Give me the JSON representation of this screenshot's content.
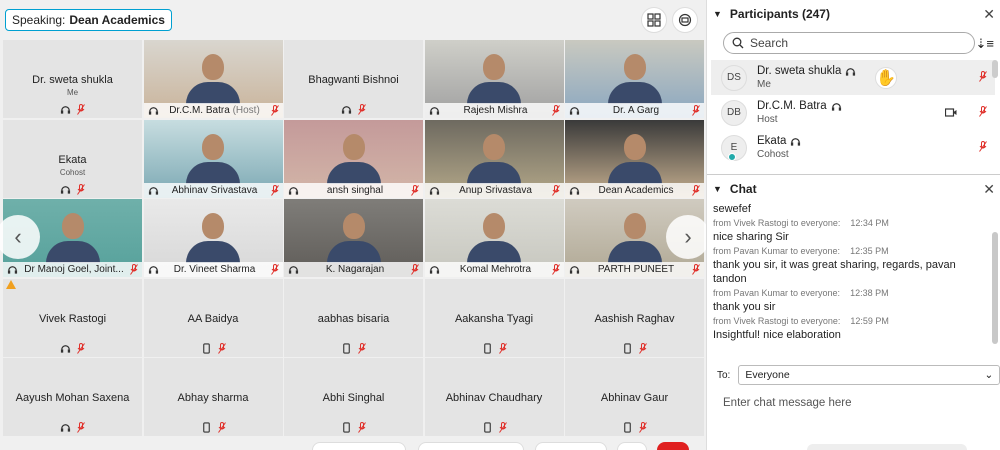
{
  "speaking": {
    "label": "Speaking:",
    "name": "Dean Academics"
  },
  "tiles": [
    {
      "name": "Dr. sweta shukla",
      "role": "Me",
      "video": false
    },
    {
      "name": "Dr.C.M. Batra",
      "host": "(Host)",
      "video": true
    },
    {
      "name": "Bhagwanti Bishnoi",
      "video": false
    },
    {
      "name": "Rajesh Mishra",
      "video": true
    },
    {
      "name": "Dr. A Garg",
      "video": true
    },
    {
      "name": "Ekata",
      "role": "Cohost",
      "video": false
    },
    {
      "name": "Abhinav Srivastava",
      "video": true
    },
    {
      "name": "ansh singhal",
      "video": true
    },
    {
      "name": "Anup Srivastava",
      "video": true
    },
    {
      "name": "Dean Academics",
      "video": true,
      "highlight": true
    },
    {
      "name": "Dr Manoj Goel, Joint...",
      "video": true
    },
    {
      "name": "Dr. Vineet Sharma",
      "video": true
    },
    {
      "name": "K. Nagarajan",
      "video": true
    },
    {
      "name": "Komal Mehrotra",
      "video": true
    },
    {
      "name": "PARTH PUNEET",
      "video": true
    },
    {
      "name": "Vivek Rastogi",
      "video": false
    },
    {
      "name": "AA Baidya",
      "video": false
    },
    {
      "name": "aabhas bisaria",
      "video": false
    },
    {
      "name": "Aakansha Tyagi",
      "video": false
    },
    {
      "name": "Aashish Raghav",
      "video": false
    },
    {
      "name": "Aayush Mohan Saxena",
      "video": false
    },
    {
      "name": "Abhay sharma",
      "video": false
    },
    {
      "name": "Abhi Singhal",
      "video": false
    },
    {
      "name": "Abhinav Chaudhary",
      "video": false
    },
    {
      "name": "Abhinav Gaur",
      "video": false
    }
  ],
  "participants": {
    "title": "Participants (247)",
    "search_placeholder": "Search",
    "items": [
      {
        "initials": "DS",
        "name": "Dr. sweta shukla",
        "role": "Me"
      },
      {
        "initials": "DB",
        "name": "Dr.C.M. Batra",
        "role": "Host"
      },
      {
        "initials": "E",
        "name": "Ekata",
        "role": "Cohost"
      }
    ]
  },
  "chat": {
    "title": "Chat",
    "messages": [
      {
        "text": "sewefef"
      },
      {
        "meta_from": "from Vivek Rastogi to everyone:",
        "time": "12:34 PM"
      },
      {
        "text": "nice sharing Sir"
      },
      {
        "meta_from": "from Pavan Kumar to everyone:",
        "time": "12:35 PM"
      },
      {
        "text": "thank you sir,  it was great sharing, regards, pavan tandon"
      },
      {
        "meta_from": "from Pavan Kumar to everyone:",
        "time": "12:38 PM"
      },
      {
        "text": "thank you sir"
      },
      {
        "meta_from": "from Vivek Rastogi to everyone:",
        "time": "12:59 PM"
      },
      {
        "text": "Insightful! nice elaboration"
      }
    ],
    "to_label": "To:",
    "to_value": "Everyone",
    "input_placeholder": "Enter chat message here"
  },
  "colors": {
    "accent": "#00a0d1",
    "mute_red": "#e0302a",
    "highlight": "#33b5e5"
  }
}
